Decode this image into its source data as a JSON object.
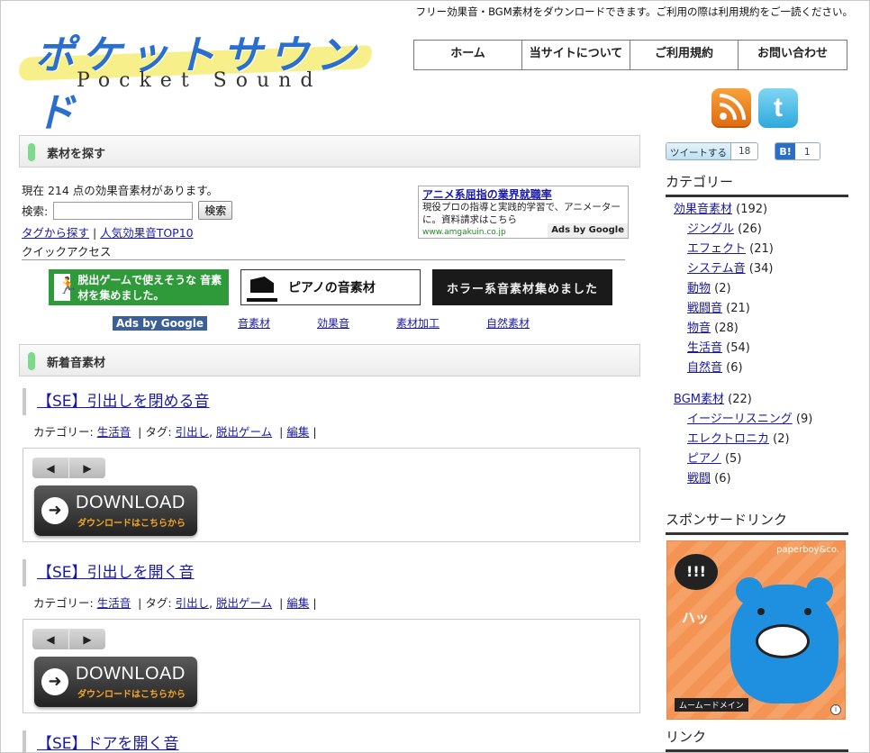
{
  "header": {
    "tagline": "フリー効果音・BGM素材をダウンロードできます。ご利用の際は利用規約をご一読ください。",
    "logo_jp": "ポケットサウンド",
    "logo_en": "Pocket Sound",
    "nav": [
      "ホーム",
      "当サイトについて",
      "ご利用規約",
      "お問い合わせ"
    ],
    "twitter_glyph": "t"
  },
  "search_section": {
    "heading": "素材を探す",
    "count_text": "現在 214 点の効果音素材があります。",
    "search_label": "検索:",
    "search_value": "",
    "search_button": "検索",
    "tag_link": "タグから探す",
    "separator": "|",
    "top10_link": "人気効果音TOP10",
    "quick_access": "クイックアクセス"
  },
  "ad": {
    "title": "アニメ系屈指の業界就職率",
    "body": "現役プロの指導と実践的学習で、アニメーターに。資料請求はこちら",
    "url": "www.amgakuin.co.jp",
    "ads_by": "Ads by Google"
  },
  "banners": {
    "green": "脱出ゲームで使えそうな 音素材を集めました。",
    "piano": "ピアノの音素材",
    "horror": "ホラー系音素材集めました"
  },
  "ad_links": {
    "badge": "Ads by Google",
    "links": [
      "音素材",
      "効果音",
      "素材加工",
      "自然素材"
    ]
  },
  "new_section": {
    "heading": "新着音素材"
  },
  "meta_labels": {
    "category": "カテゴリー:",
    "tag": "| タグ:",
    "edit": "編集",
    "bar": "|"
  },
  "posts": [
    {
      "title": "【SE】引出しを閉める音",
      "category": "生活音",
      "tags": [
        "引出し",
        "脱出ゲーム"
      ]
    },
    {
      "title": "【SE】引出しを開く音",
      "category": "生活音",
      "tags": [
        "引出し",
        "脱出ゲーム"
      ]
    },
    {
      "title": "【SE】ドアを開く音"
    }
  ],
  "player": {
    "prev": "◀",
    "next": "▶",
    "download_arrow": "➜",
    "download_label": "DOWNLOAD",
    "download_sub": "ダウンロードはこちらから"
  },
  "sidebar": {
    "tweet_label": "ツイートする",
    "tweet_count": "18",
    "hatena_label": "B!",
    "hatena_count": "1",
    "category_title": "カテゴリー",
    "categories": [
      {
        "name": "効果音素材",
        "count": "(192)"
      },
      {
        "name": "ジングル",
        "count": "(26)"
      },
      {
        "name": "エフェクト",
        "count": "(21)"
      },
      {
        "name": "システム音",
        "count": "(34)"
      },
      {
        "name": "動物",
        "count": "(2)"
      },
      {
        "name": "戦闘音",
        "count": "(21)"
      },
      {
        "name": "物音",
        "count": "(28)"
      },
      {
        "name": "生活音",
        "count": "(54)"
      },
      {
        "name": "自然音",
        "count": "(6)"
      },
      {
        "name": "BGM素材",
        "count": "(22)"
      },
      {
        "name": "イージーリスニング",
        "count": "(9)"
      },
      {
        "name": "エレクトロニカ",
        "count": "(2)"
      },
      {
        "name": "ピアノ",
        "count": "(5)"
      },
      {
        "name": "戦闘",
        "count": "(6)"
      }
    ],
    "sponsor_title": "スポンサードリンク",
    "sponsor_brand": "paperboy&co.",
    "sponsor_bubble": "!!!",
    "sponsor_hatsu": "ハッ",
    "sponsor_footer": "ムームードメイン",
    "sponsor_info": "i",
    "links_title": "リンク"
  },
  "colors": {
    "link": "#1a1aa6",
    "section_bar": "#7fd98b",
    "nav_border": "#777777",
    "rss": "#f08a25",
    "twitter": "#4fbde8",
    "ads_badge": "#3b5f99"
  }
}
